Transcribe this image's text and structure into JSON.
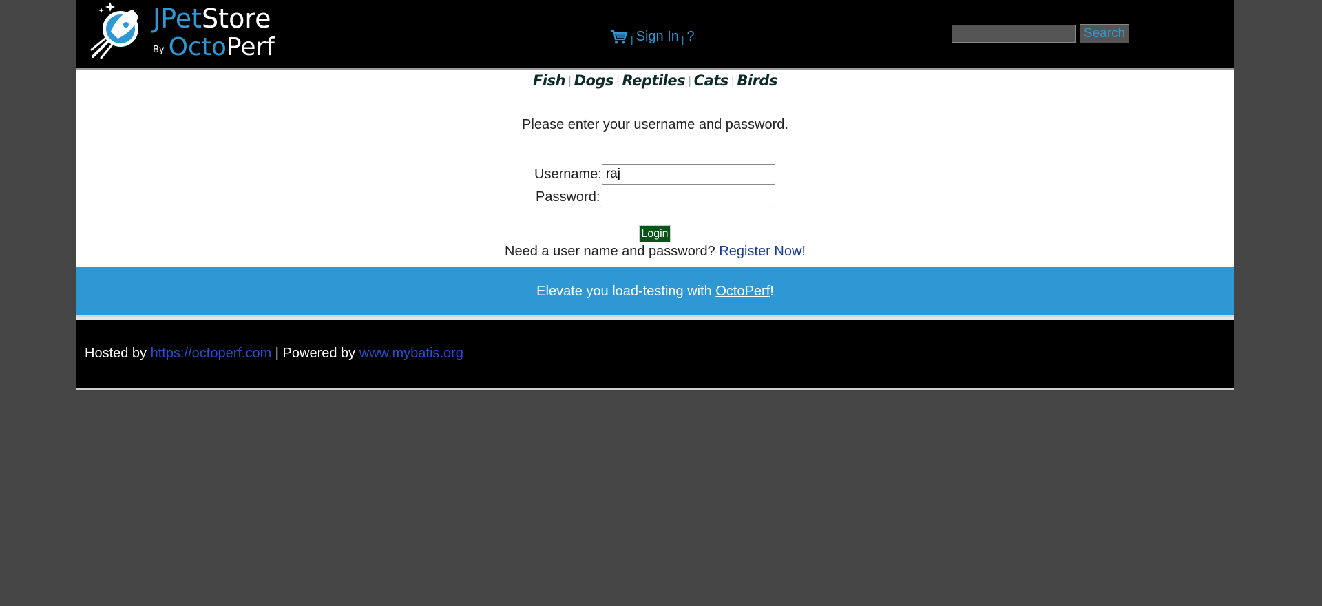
{
  "header": {
    "logo": {
      "jpet": "JPet",
      "store": "Store",
      "by": "By",
      "octo": "Octo",
      "perf": "Perf"
    },
    "menu": {
      "cart_icon": "shopping-cart-icon",
      "separator": "|",
      "sign_in": "Sign In",
      "help": "?"
    },
    "search": {
      "value": "",
      "button_label": "Search"
    }
  },
  "quicklinks": [
    "Fish",
    "Dogs",
    "Reptiles",
    "Cats",
    "Birds"
  ],
  "login": {
    "prompt": "Please enter your username and password.",
    "username_label": "Username:",
    "username_value": "raj",
    "password_label": "Password:",
    "password_value": "",
    "login_button": "Login",
    "register_prompt": "Need a user name and password?",
    "register_link": "Register Now!"
  },
  "promo": {
    "text_before": "Elevate you load-testing with ",
    "link": "OctoPerf",
    "text_after": "!"
  },
  "footer": {
    "hosted_by": "Hosted by ",
    "hosted_link": "https://octoperf.com",
    "powered_by": " | Powered by ",
    "powered_link": "www.mybatis.org"
  },
  "colors": {
    "brand_blue": "#2e98d4",
    "login_green": "#0b5218",
    "background": "#454545"
  }
}
